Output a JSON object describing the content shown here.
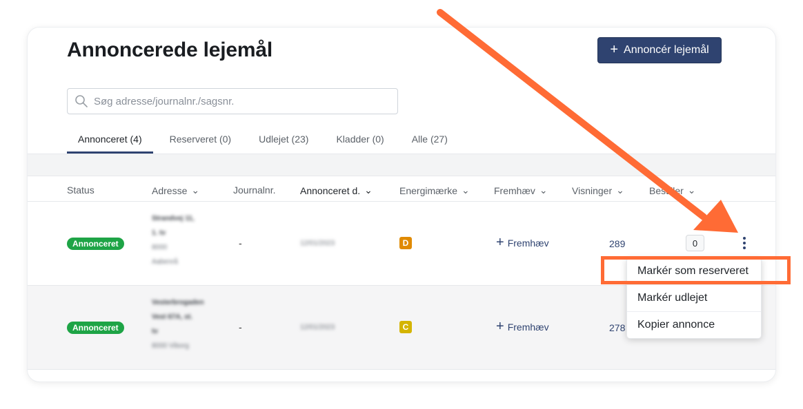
{
  "header": {
    "title": "Annoncerede lejemål",
    "primary_button": "Annoncér lejemål"
  },
  "search": {
    "placeholder": "Søg adresse/journalnr./sagsnr."
  },
  "tabs": [
    {
      "label": "Annonceret (4)",
      "active": true
    },
    {
      "label": "Reserveret (0)"
    },
    {
      "label": "Udlejet (23)"
    },
    {
      "label": "Kladder (0)"
    },
    {
      "label": "Alle (27)"
    }
  ],
  "table": {
    "columns": [
      "Status",
      "Adresse",
      "Journalnr.",
      "Annonceret d.",
      "Energimærke",
      "Fremhæv",
      "Visninger",
      "Bestiller"
    ],
    "sorted_column": "Annonceret d.",
    "rows": [
      {
        "status": "Annonceret",
        "address_line1": "Strandvej 11,",
        "address_line2": "1. tv",
        "address_line3": "8000",
        "address_line4": "Aabenrå",
        "journal": "-",
        "date": "12/01/2023",
        "energy": "D",
        "energy_color": "#e08a00",
        "feature": "Fremhæv",
        "views": "289",
        "orders": "0"
      },
      {
        "status": "Annonceret",
        "address_line1": "Vesterbrogaden",
        "address_line2": "Vest 67A, st.",
        "address_line3": "tv",
        "address_line4": "8000 Viborg",
        "journal": "-",
        "date": "12/01/2023",
        "energy": "C",
        "energy_color": "#d4b400",
        "feature": "Fremhæv",
        "views": "278"
      }
    ]
  },
  "menu": {
    "items": [
      "Markér som reserveret",
      "Markér udlejet",
      "Kopier annonce"
    ]
  },
  "colors": {
    "brand": "#2f4370",
    "status_green": "#1ea446",
    "annotation": "#ff6b35"
  }
}
